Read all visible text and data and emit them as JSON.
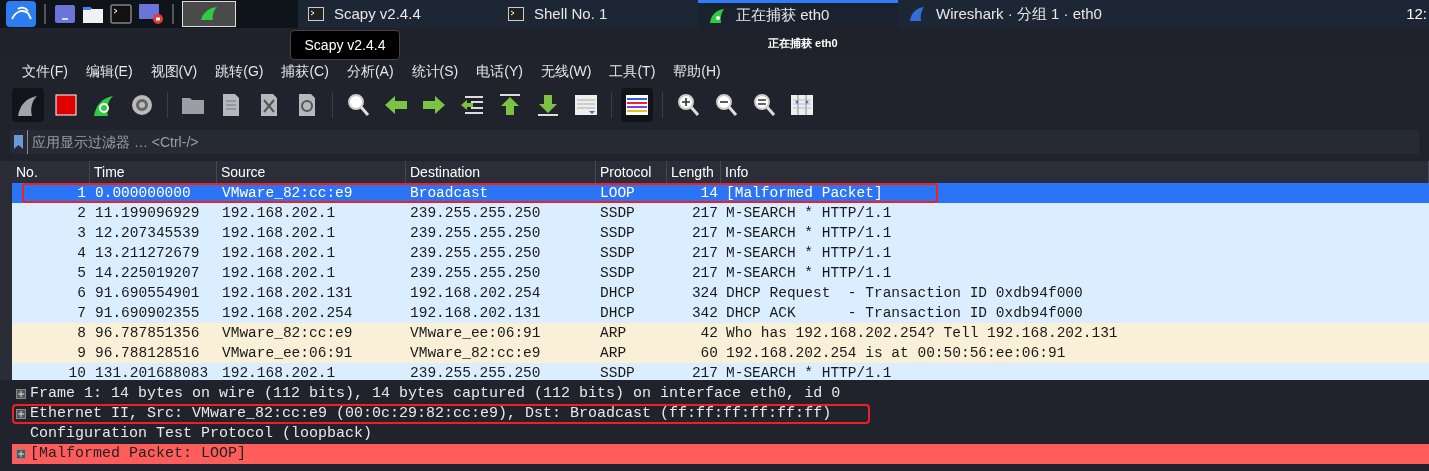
{
  "taskbar": {
    "launchers": [
      {
        "kind": "kali"
      },
      {
        "kind": "separator"
      },
      {
        "kind": "desktop"
      },
      {
        "kind": "files"
      },
      {
        "kind": "terminal"
      },
      {
        "kind": "recorder"
      },
      {
        "kind": "separator"
      },
      {
        "kind": "thumbnail"
      }
    ],
    "tasks": [
      {
        "label": "Scapy v2.4.4",
        "kind": "terminal",
        "selected": false
      },
      {
        "label": "Shell No. 1",
        "kind": "terminal",
        "selected": false
      },
      {
        "label": "正在捕获 eth0",
        "kind": "capture",
        "selected": true
      },
      {
        "label": "Wireshark · 分组 1 · eth0",
        "kind": "wireshark",
        "selected": false
      }
    ],
    "clock": "12:"
  },
  "window": {
    "title": "正在捕获 eth0"
  },
  "tooltip": "Scapy v2.4.4",
  "menu": [
    "文件(F)",
    "编辑(E)",
    "视图(V)",
    "跳转(G)",
    "捕获(C)",
    "分析(A)",
    "统计(S)",
    "电话(Y)",
    "无线(W)",
    "工具(T)",
    "帮助(H)"
  ],
  "toolbar": [
    {
      "kind": "start",
      "pressed": true
    },
    {
      "kind": "stop",
      "pressed": false
    },
    {
      "kind": "restart",
      "pressed": false
    },
    {
      "kind": "options",
      "pressed": false
    },
    {
      "kind": "separator"
    },
    {
      "kind": "open",
      "pressed": false
    },
    {
      "kind": "save",
      "pressed": false
    },
    {
      "kind": "close",
      "pressed": false
    },
    {
      "kind": "reload",
      "pressed": false
    },
    {
      "kind": "separator"
    },
    {
      "kind": "find",
      "pressed": false
    },
    {
      "kind": "back",
      "pressed": false
    },
    {
      "kind": "forward",
      "pressed": false
    },
    {
      "kind": "goto",
      "pressed": false
    },
    {
      "kind": "first",
      "pressed": false
    },
    {
      "kind": "last",
      "pressed": false
    },
    {
      "kind": "autoscroll",
      "pressed": false
    },
    {
      "kind": "separator"
    },
    {
      "kind": "colorize",
      "pressed": true
    },
    {
      "kind": "separator"
    },
    {
      "kind": "zoom-in",
      "pressed": false
    },
    {
      "kind": "zoom-out",
      "pressed": false
    },
    {
      "kind": "zoom-reset",
      "pressed": false
    },
    {
      "kind": "resize",
      "pressed": false
    }
  ],
  "filter": {
    "placeholder": "应用显示过滤器 … <Ctrl-/>"
  },
  "packet_list": {
    "columns": [
      "No.",
      "Time",
      "Source",
      "Destination",
      "Protocol",
      "Length",
      "Info"
    ],
    "rows": [
      {
        "cells": [
          "1",
          "0.000000000",
          "VMware_82:cc:e9",
          "Broadcast",
          "LOOP",
          "14",
          "[Malformed Packet]"
        ],
        "selected": true,
        "outlined": true
      },
      {
        "cells": [
          "2",
          "11.199096929",
          "192.168.202.1",
          "239.255.255.250",
          "SSDP",
          "217",
          "M-SEARCH * HTTP/1.1"
        ],
        "selected": false,
        "outlined": false,
        "color": "#daeeff"
      },
      {
        "cells": [
          "3",
          "12.207345539",
          "192.168.202.1",
          "239.255.255.250",
          "SSDP",
          "217",
          "M-SEARCH * HTTP/1.1"
        ],
        "selected": false,
        "outlined": false,
        "color": "#daeeff"
      },
      {
        "cells": [
          "4",
          "13.211272679",
          "192.168.202.1",
          "239.255.255.250",
          "SSDP",
          "217",
          "M-SEARCH * HTTP/1.1"
        ],
        "selected": false,
        "outlined": false,
        "color": "#daeeff"
      },
      {
        "cells": [
          "5",
          "14.225019207",
          "192.168.202.1",
          "239.255.255.250",
          "SSDP",
          "217",
          "M-SEARCH * HTTP/1.1"
        ],
        "selected": false,
        "outlined": false,
        "color": "#daeeff"
      },
      {
        "cells": [
          "6",
          "91.690554901",
          "192.168.202.131",
          "192.168.202.254",
          "DHCP",
          "324",
          "DHCP Request  - Transaction ID 0xdb94f000"
        ],
        "selected": false,
        "outlined": false,
        "color": "#daeeff"
      },
      {
        "cells": [
          "7",
          "91.690902355",
          "192.168.202.254",
          "192.168.202.131",
          "DHCP",
          "342",
          "DHCP ACK      - Transaction ID 0xdb94f000"
        ],
        "selected": false,
        "outlined": false,
        "color": "#daeeff"
      },
      {
        "cells": [
          "8",
          "96.787851356",
          "VMware_82:cc:e9",
          "VMware_ee:06:91",
          "ARP",
          "42",
          "Who has 192.168.202.254? Tell 192.168.202.131"
        ],
        "selected": false,
        "outlined": false,
        "color": "#faf0d7"
      },
      {
        "cells": [
          "9",
          "96.788128516",
          "VMware_ee:06:91",
          "VMware_82:cc:e9",
          "ARP",
          "60",
          "192.168.202.254 is at 00:50:56:ee:06:91"
        ],
        "selected": false,
        "outlined": false,
        "color": "#faf0d7"
      },
      {
        "cells": [
          "10",
          "131.201688083",
          "192.168.202.1",
          "239.255.255.250",
          "SSDP",
          "217",
          "M-SEARCH * HTTP/1.1"
        ],
        "selected": false,
        "outlined": false,
        "color": "#daeeff"
      }
    ]
  },
  "details": [
    {
      "text": "Frame 1: 14 bytes on wire (112 bits), 14 bytes captured (112 bits) on interface eth0, id 0",
      "expandable": true,
      "outlined": false
    },
    {
      "text": "Ethernet II, Src: VMware_82:cc:e9 (00:0c:29:82:cc:e9), Dst: Broadcast (ff:ff:ff:ff:ff:ff)",
      "expandable": true,
      "outlined": true
    },
    {
      "text": "Configuration Test Protocol (loopback)",
      "expandable": false,
      "outlined": false
    },
    {
      "text": "[Malformed Packet: LOOP]",
      "expandable": true,
      "outlined": false,
      "color": "#ff5c5c"
    }
  ]
}
